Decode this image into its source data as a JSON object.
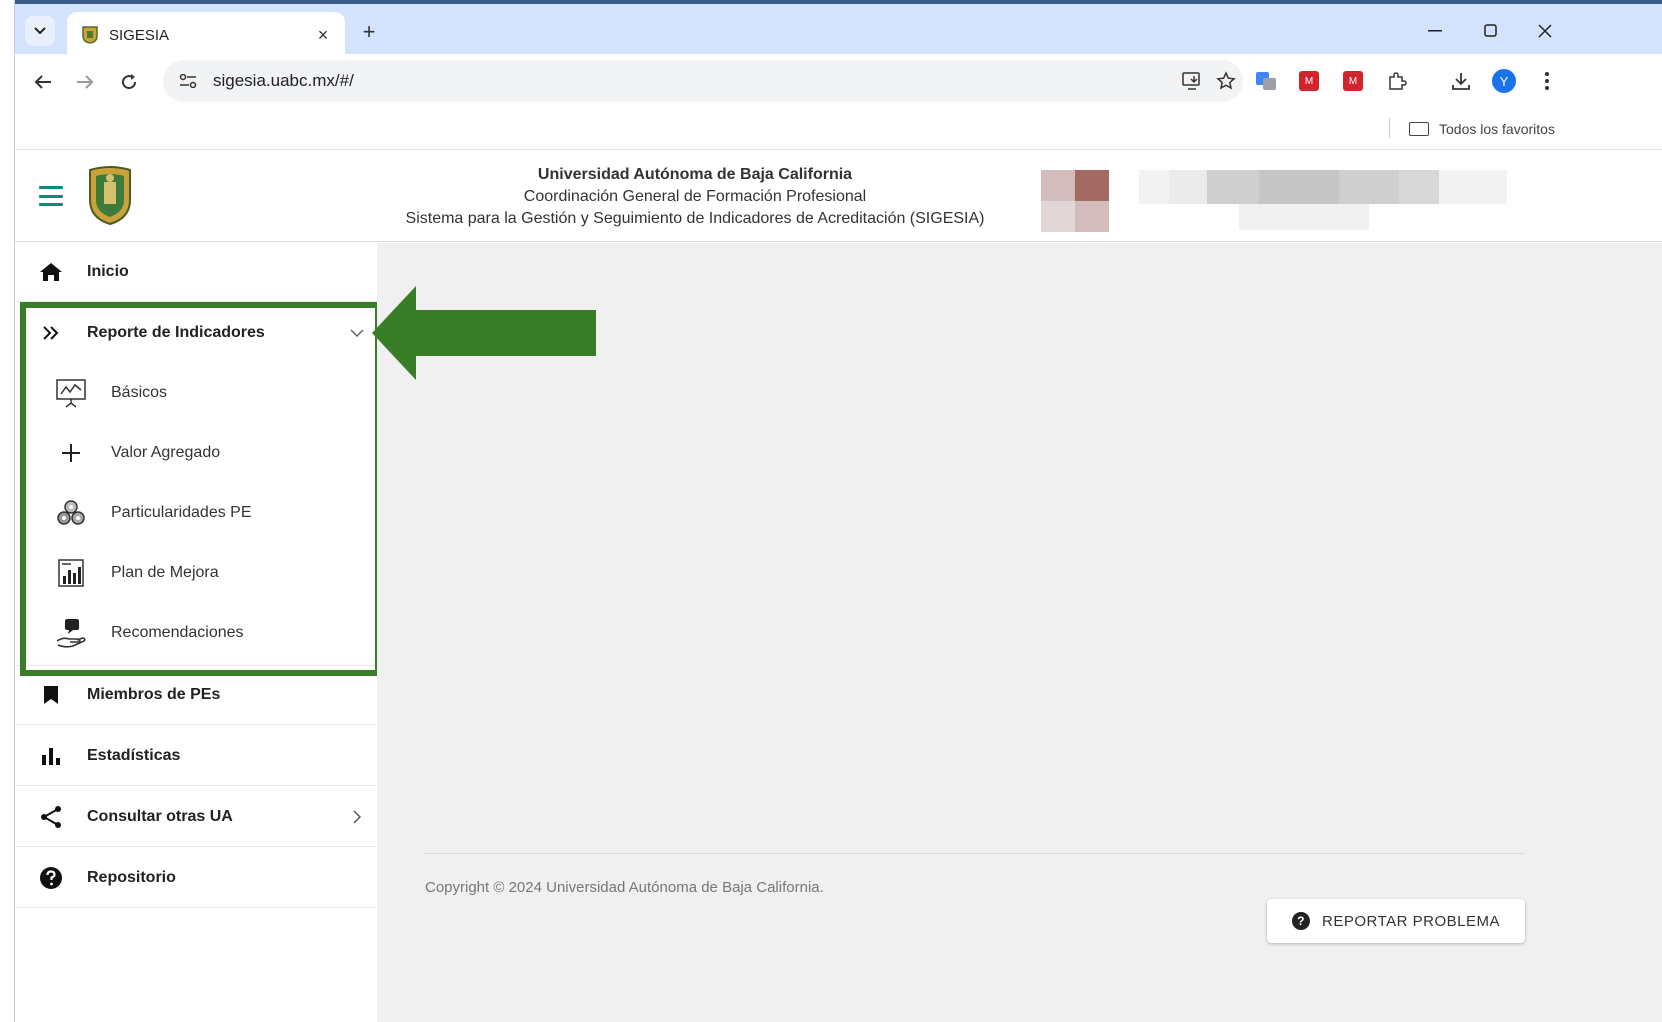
{
  "browser": {
    "tab_title": "SIGESIA",
    "tab_close": "×",
    "new_tab": "+",
    "url": "sigesia.uabc.mx/#/",
    "avatar_letter": "Y",
    "bookmarks_label": "Todos los favoritos"
  },
  "header": {
    "line1": "Universidad Autónoma de Baja California",
    "line2": "Coordinación General de Formación Profesional",
    "line3": "Sistema para la Gestión y Seguimiento de Indicadores de Acreditación (SIGESIA)"
  },
  "sidebar": {
    "items": [
      {
        "label": "Inicio",
        "icon": "home-icon"
      },
      {
        "label": "Reporte de Indicadores",
        "icon": "double-chevron-right-icon"
      },
      {
        "label": "Miembros de PEs",
        "icon": "bookmark-icon"
      },
      {
        "label": "Estadísticas",
        "icon": "bar-chart-icon"
      },
      {
        "label": "Consultar otras UA",
        "icon": "share-icon"
      },
      {
        "label": "Repositorio",
        "icon": "help-circle-icon"
      }
    ],
    "subitems": [
      {
        "label": "Básicos",
        "icon": "presentation-chart-icon"
      },
      {
        "label": "Valor Agregado",
        "icon": "plus-icon"
      },
      {
        "label": "Particularidades PE",
        "icon": "gears-icon"
      },
      {
        "label": "Plan de Mejora",
        "icon": "chart-report-icon"
      },
      {
        "label": "Recomendaciones",
        "icon": "hand-chat-icon"
      }
    ]
  },
  "footer": {
    "copyright": "Copyright © 2024 Universidad Autónoma de Baja California.",
    "report_button": "REPORTAR PROBLEMA"
  },
  "colors": {
    "highlight": "#3a7d28",
    "menu_icon": "#0f8a7e",
    "tabstrip": "#d3e3fd"
  }
}
